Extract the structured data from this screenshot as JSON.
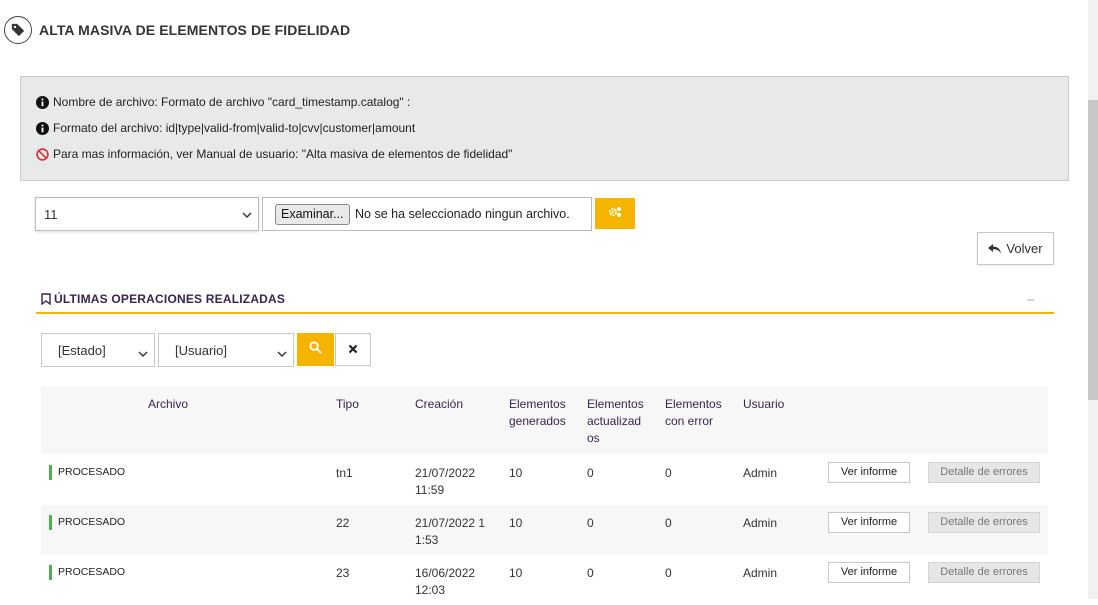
{
  "page": {
    "title": "ALTA MASIVA DE ELEMENTOS DE FIDELIDAD",
    "icon": "tag-icon"
  },
  "info": {
    "line1": "Nombre de archivo: Formato de archivo \"card_timestamp.catalog\" :",
    "line2": "Formato del archivo: id|type|valid-from|valid-to|cvv|customer|amount",
    "line3": "Para mas información, ver Manual de usuario: \"Alta masiva de elementos de fidelidad\""
  },
  "upload": {
    "store_value": "11",
    "browse_label": "Examinar...",
    "no_file_text": "No se ha seleccionado ningun archivo."
  },
  "volver_label": "Volver",
  "section": {
    "title": "ÚLTIMAS OPERACIONES REALIZADAS",
    "collapse": "–"
  },
  "filters": {
    "estado": "[Estado]",
    "usuario": "[Usuario]"
  },
  "table": {
    "headers": {
      "archivo": "Archivo",
      "tipo": "Tipo",
      "creacion": "Creación",
      "generados": [
        "Elementos",
        "generados"
      ],
      "actualizados": [
        "Elementos",
        "actualizad",
        "os"
      ],
      "error": [
        "Elementos",
        "con error"
      ],
      "usuario": "Usuario"
    },
    "rows": [
      {
        "estado": "PROCESADO",
        "tipo": "tn1",
        "creacion": [
          "21/07/2022",
          "11:59"
        ],
        "generados": "10",
        "actualizados": "0",
        "error": "0",
        "usuario": "Admin",
        "ver": "Ver informe",
        "detalle": "Detalle de errores"
      },
      {
        "estado": "PROCESADO",
        "tipo": "22",
        "creacion": [
          "21/07/2022 1",
          "1:53"
        ],
        "generados": "10",
        "actualizados": "0",
        "error": "0",
        "usuario": "Admin",
        "ver": "Ver informe",
        "detalle": "Detalle de errores"
      },
      {
        "estado": "PROCESADO",
        "tipo": "23",
        "creacion": [
          "16/06/2022",
          "12:03"
        ],
        "generados": "10",
        "actualizados": "0",
        "error": "0",
        "usuario": "Admin",
        "ver": "Ver informe",
        "detalle": "Detalle de errores"
      }
    ]
  },
  "colors": {
    "accent": "#f5b400",
    "heading": "#3a2451",
    "status_ok": "#4caf50"
  }
}
